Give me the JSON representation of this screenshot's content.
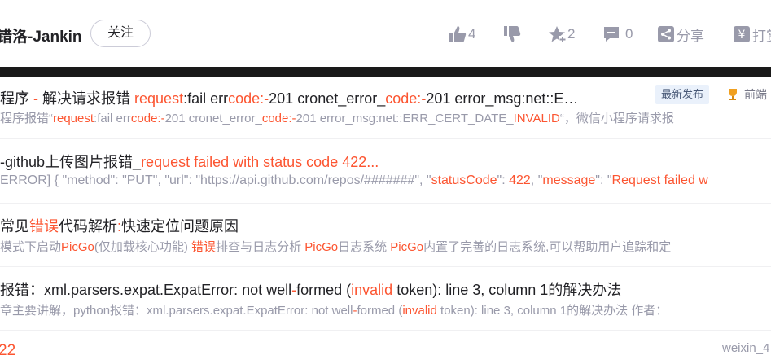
{
  "header": {
    "author_name": "错洛-Jankin",
    "follow_label": "关注",
    "like_count": "4",
    "favorite_count": "2",
    "comment_count": "0",
    "share_label": "分享",
    "tip_label": "打赏"
  },
  "results": [
    {
      "title_parts": [
        "程序 ",
        "- ",
        "解决请求报错 ",
        "request",
        ":fail err",
        "code",
        ":",
        "-",
        "201 cronet_error_",
        "code",
        ":",
        "-",
        "201 error_msg:net::E…"
      ],
      "title_hl": [
        false,
        true,
        false,
        true,
        false,
        true,
        true,
        true,
        false,
        true,
        true,
        true,
        false
      ],
      "desc_parts": [
        "程序报错“",
        "request",
        ":fail err",
        "code",
        ":",
        "-",
        "201 cronet_error_",
        "code",
        ":",
        "-",
        "201 error_msg:net::ERR_CERT_DATE_",
        "INVALID",
        "“，微信小程序请求报"
      ],
      "desc_hl": [
        false,
        true,
        false,
        true,
        true,
        true,
        false,
        true,
        true,
        true,
        false,
        true,
        false
      ],
      "badge": "最新发布",
      "badge_right": "前端"
    },
    {
      "title_parts": [
        "-github上传图片报错_",
        "request failed with status code 422..."
      ],
      "title_hl": [
        false,
        true
      ],
      "desc_parts": [
        "ERROR] { \"method\": \"PUT\", \"url\": \"https://api.github.com/repos/#######\", \"",
        "statusCode",
        "\": ",
        "422",
        ", \"",
        "message",
        "\": \"",
        "Request failed w"
      ],
      "desc_hl": [
        false,
        true,
        false,
        true,
        false,
        true,
        false,
        true
      ]
    },
    {
      "title_parts": [
        "常见",
        "错误",
        "代码解析",
        ":",
        "快速定位问题原因"
      ],
      "title_hl": [
        false,
        true,
        false,
        true,
        false
      ],
      "desc_parts": [
        "模式下启动",
        "PicGo",
        "(仅加载核心功能) ",
        "错误",
        "排查与日志分析 ",
        "PicGo",
        "日志系统 ",
        "PicGo",
        "内置了完善的日志系统,可以帮助用户追踪和定"
      ],
      "desc_hl": [
        false,
        true,
        false,
        true,
        false,
        true,
        false,
        true,
        false
      ]
    },
    {
      "title_parts": [
        "报错：xml.parsers.expat.ExpatError: not well",
        "-",
        "formed (",
        "invalid",
        " token): line 3, column 1的解决办法"
      ],
      "title_hl": [
        false,
        true,
        false,
        true,
        false
      ],
      "desc_parts": [
        "章主要讲解，python报错：xml.parsers.expat.ExpatError: not well",
        "-",
        "formed (",
        "invalid",
        " token): line 3, column 1的解决办法 作者："
      ],
      "desc_hl": [
        false,
        true,
        false,
        true,
        false
      ]
    }
  ],
  "footer": {
    "number": "22",
    "username": "weixin_4"
  },
  "colors": {
    "highlight": "#fc5531",
    "muted": "#999aaa",
    "text": "#222226"
  }
}
